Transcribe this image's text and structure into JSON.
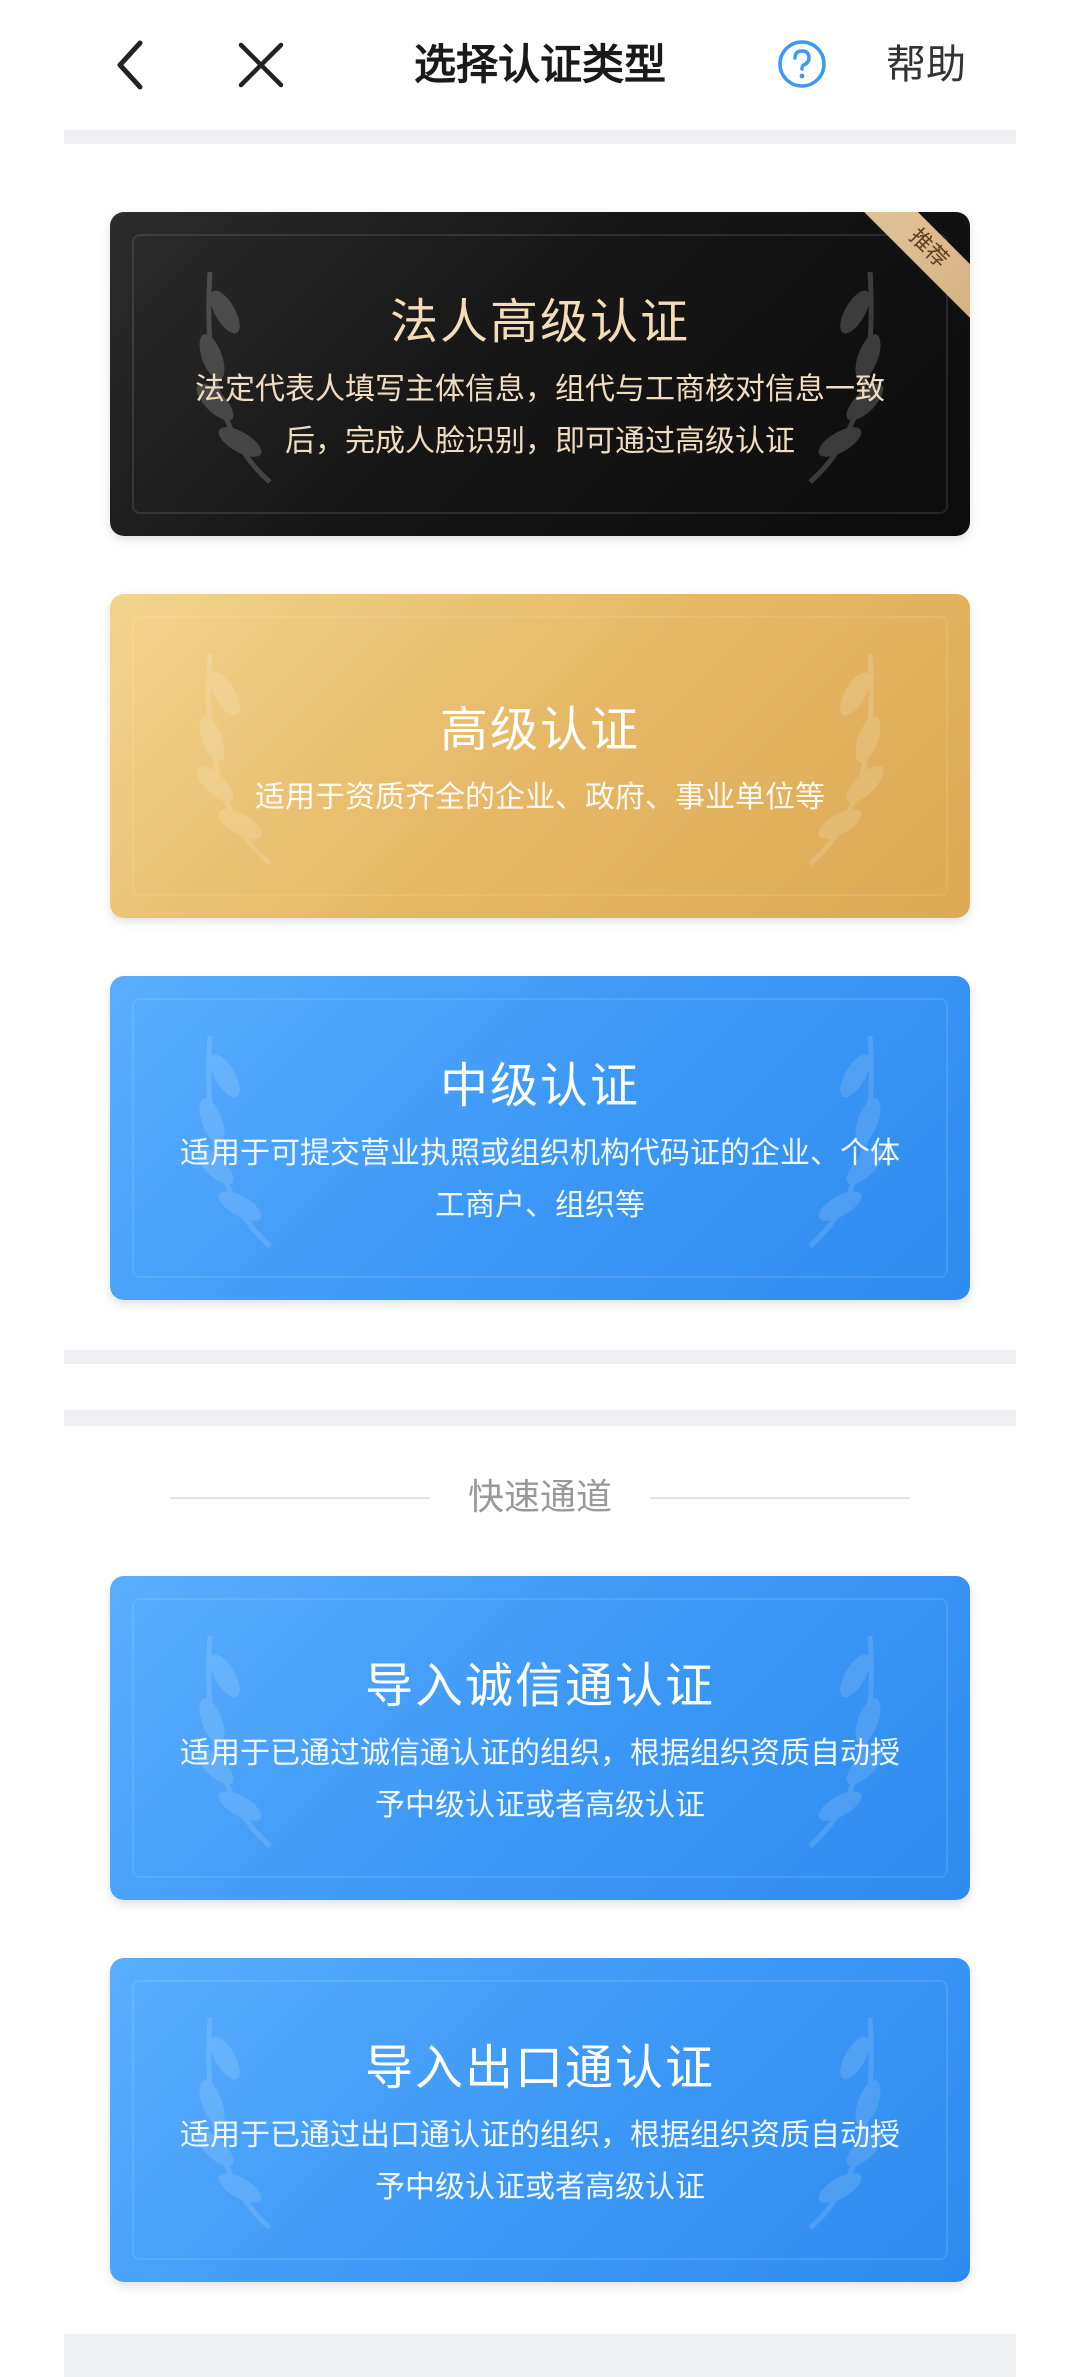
{
  "header": {
    "title": "选择认证类型",
    "help_label": "帮助"
  },
  "cards": [
    {
      "title": "法人高级认证",
      "desc": "法定代表人填写主体信息，组代与工商核对信息一致后，完成人脸识别，即可通过高级认证",
      "ribbon": "推荐",
      "style": "dark"
    },
    {
      "title": "高级认证",
      "desc": "适用于资质齐全的企业、政府、事业单位等",
      "style": "gold"
    },
    {
      "title": "中级认证",
      "desc": "适用于可提交营业执照或组织机构代码证的企业、个体工商户、组织等",
      "style": "blue"
    }
  ],
  "fast_channel": {
    "label": "快速通道",
    "cards": [
      {
        "title": "导入诚信通认证",
        "desc": "适用于已通过诚信通认证的组织，根据组织资质自动授予中级认证或者高级认证",
        "style": "blue"
      },
      {
        "title": "导入出口通认证",
        "desc": "适用于已通过出口通认证的组织，根据组织资质自动授予中级认证或者高级认证",
        "style": "blue"
      }
    ]
  },
  "colors": {
    "accent_blue": "#3d99f6",
    "gold": "#e6b866",
    "dark": "#161616",
    "help_icon": "#3d99f6",
    "divider": "#eeeff2"
  },
  "icons": {
    "back": "chevron-left-icon",
    "close": "close-icon",
    "help": "question-circle-icon"
  }
}
